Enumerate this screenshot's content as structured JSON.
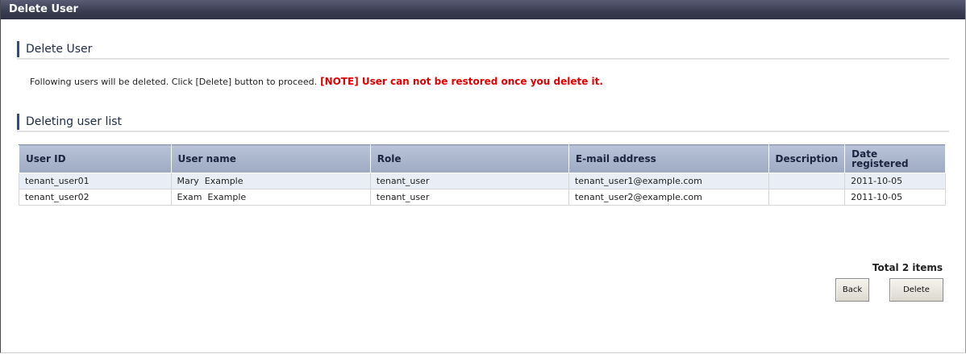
{
  "window": {
    "title": "Delete User"
  },
  "section_delete": {
    "title": "Delete User",
    "instruction": "Following users will be deleted. Click [Delete] button to proceed.",
    "warning": "[NOTE] User can not be restored once you delete it."
  },
  "section_list": {
    "title": "Deleting user list"
  },
  "table": {
    "columns": {
      "user_id": "User ID",
      "user_name": "User name",
      "role": "Role",
      "email": "E-mail address",
      "description": "Description",
      "date_line1": "Date",
      "date_line2": "registered"
    },
    "rows": [
      {
        "user_id": "tenant_user01",
        "user_name": "Mary  Example",
        "role": "tenant_user",
        "email": "tenant_user1@example.com",
        "description": "",
        "date": "2011-10-05"
      },
      {
        "user_id": "tenant_user02",
        "user_name": "Exam  Example",
        "role": "tenant_user",
        "email": "tenant_user2@example.com",
        "description": "",
        "date": "2011-10-05"
      }
    ]
  },
  "footer": {
    "total": "Total 2 items",
    "back_label": "Back",
    "delete_label": "Delete"
  }
}
